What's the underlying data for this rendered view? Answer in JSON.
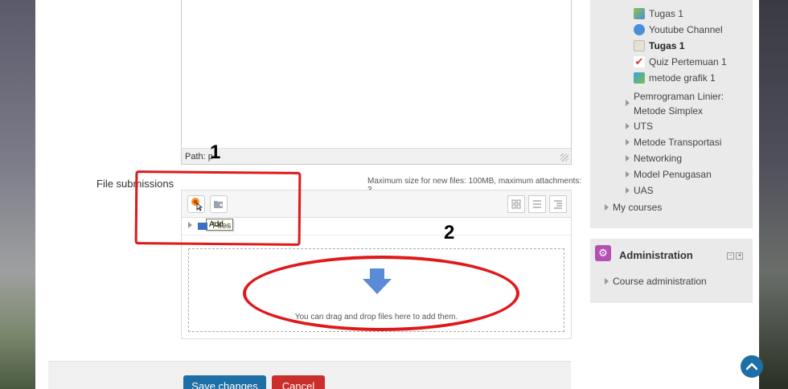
{
  "editor": {
    "path_label": "Path: p"
  },
  "annotations": {
    "one": "1",
    "two": "2"
  },
  "file_submissions": {
    "label": "File submissions",
    "max_size": "Maximum size for new files: 100MB, maximum attachments: 3",
    "add_tooltip": "Add...",
    "files_label": "Files",
    "drop_text": "You can drag and drop files here to add them."
  },
  "buttons": {
    "save": "Save changes",
    "cancel": "Cancel"
  },
  "nav": {
    "items": [
      {
        "label": "Tugas 1",
        "icon": "forum-icon"
      },
      {
        "label": "Youtube Channel",
        "icon": "url-icon"
      },
      {
        "label": "Tugas 1",
        "icon": "assignment-icon",
        "current": true
      },
      {
        "label": "Quiz Pertemuan 1",
        "icon": "quiz-icon"
      },
      {
        "label": "metode grafik 1",
        "icon": "image-icon"
      }
    ],
    "sections": [
      {
        "label_line1": "Pemrograman Linier:",
        "label_line2": "Metode Simplex"
      },
      {
        "label": "UTS"
      },
      {
        "label": "Metode Transportasi"
      },
      {
        "label": "Networking"
      },
      {
        "label": "Model Penugasan"
      },
      {
        "label": "UAS"
      }
    ],
    "my_courses": "My courses"
  },
  "administration": {
    "title": "Administration",
    "course_admin": "Course administration"
  },
  "colors": {
    "primary": "#1d6fa5",
    "danger": "#c9302c",
    "annotation_red": "#e0181a",
    "admin_icon": "#b44fb4"
  }
}
